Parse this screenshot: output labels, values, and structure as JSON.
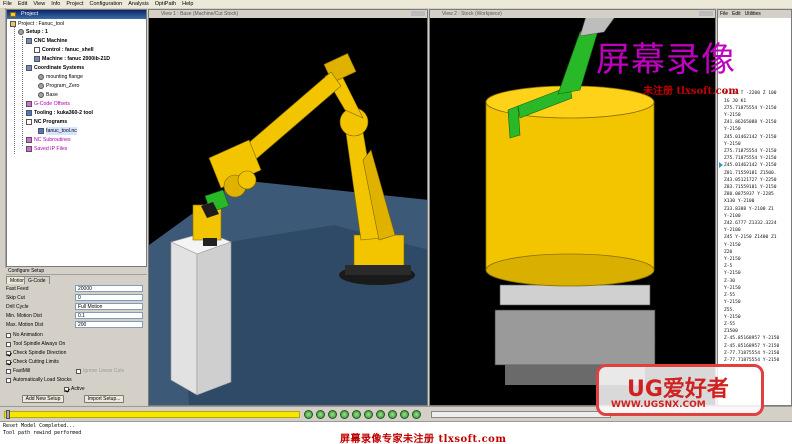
{
  "menubar": {
    "items": [
      "File",
      "Edit",
      "View",
      "Info",
      "Project",
      "Configuration",
      "Analysis",
      "OptiPath",
      "Help"
    ]
  },
  "project": {
    "panel_title": "Project",
    "root": "Project : Fanuc_tool",
    "setup": "Setup : 1",
    "cnc_machine": "CNC Machine",
    "control": "Control : fanuc_shell",
    "machine": "Machine : fanuc 2000ib-21D",
    "coord_systems": "Coordinate Systems",
    "coord_items": [
      "mounting flange",
      "Program_Zero",
      "Base"
    ],
    "gcode_offsets": "G-Code Offsets",
    "tooling": "Tooling : kuka360-2 tool",
    "nc_programs": "NC Programs",
    "nc_file": "fanuc_tool.nc",
    "nc_subroutines": "NC Subroutines",
    "saved_ip": "Saved IP Files"
  },
  "config": {
    "title": "Configure Setup",
    "tabs": [
      "Motion",
      "G-Code"
    ],
    "fields": [
      {
        "label": "Fast Feed",
        "value": "20000"
      },
      {
        "label": "Skip Cut",
        "value": "0"
      },
      {
        "label": "Drill Cycle",
        "value": "Full Motion"
      },
      {
        "label": "Min. Motion Dist",
        "value": "0.1"
      },
      {
        "label": "Max. Motion Dist",
        "value": "200"
      }
    ],
    "checks": [
      {
        "label": "No Animation",
        "checked": false
      },
      {
        "label": "Tool Spindle Always On",
        "checked": false
      },
      {
        "label": "Check Spindle Direction",
        "checked": true
      },
      {
        "label": "Check Cutting Limits",
        "checked": true
      },
      {
        "label": "FastMill",
        "checked": false
      },
      {
        "label": "Automatically Load Stocks",
        "checked": false
      }
    ],
    "fastmill_option": "Ignore Linear Cuts",
    "active_label": "Active",
    "add_button": "Add New Setup",
    "import_button": "Import Setup..."
  },
  "views": {
    "view1_title": "View 1 : Base (Machine/Cut Stock)",
    "view2_title": "View 2 : Stock (Workpiece)"
  },
  "code_panel": {
    "menu": [
      "File",
      "Edit",
      "Utilities"
    ],
    "lines": [
      "X 120 T -2200 Z 100",
      "IG J0 K1",
      "Z75.71875554 Y-2150",
      "Y-2150",
      "Z41.86265088 Y-2150",
      "Y-2150",
      "Z45.01462142 Y-2150",
      "Y-2150",
      "Z75.71875554 Y-2150",
      "Z75.71875554 Y-2150",
      "Z45.01462142 Y-2150",
      "Z81.71559181 Z1500.",
      "Z43.05121727 Y-2250",
      "Z83.71559181 Y-2150",
      "Z80.0875937 Y-2285",
      "X130 Y-2100",
      "Z33.8388 Y-2100 Z1",
      "Y-2100",
      "Z42.6777 Z1332.3224",
      "Y-2100",
      "Z45 Y-2150 Z1400 Z1",
      "Y-2150",
      "Z20",
      "Y-2150",
      "Z-5",
      "Y-2150",
      "Z-30",
      "Y-2150",
      "Z-55",
      "Y-2150",
      "Z55.",
      "Y-2150",
      "Z-55",
      "Z1500",
      "Z-45.85168957 Y-2150",
      "Z-45.85168957 Y-2150",
      "Z-77.71875554 Y-2150",
      "Z-77.71875554 Y-2150"
    ]
  },
  "status": {
    "lines": [
      "Reset Model Completed...",
      "Tool path rewind performed"
    ]
  },
  "watermarks": {
    "recorder": "屏幕录像",
    "unregistered": "未注册 tlxsoft.com",
    "footer": "屏幕录像专家未注册 tlxsoft.com",
    "logo_title": "UG爱好者",
    "logo_url": "WWW.UGSNX.COM"
  },
  "colors": {
    "robot_yellow": "#f2c500",
    "tool_green": "#28b828",
    "floor_blue": "#3c5a78",
    "stock_white": "#e8e8e8",
    "title_blue": "#0a246a",
    "slider_yellow": "#f7e600"
  }
}
